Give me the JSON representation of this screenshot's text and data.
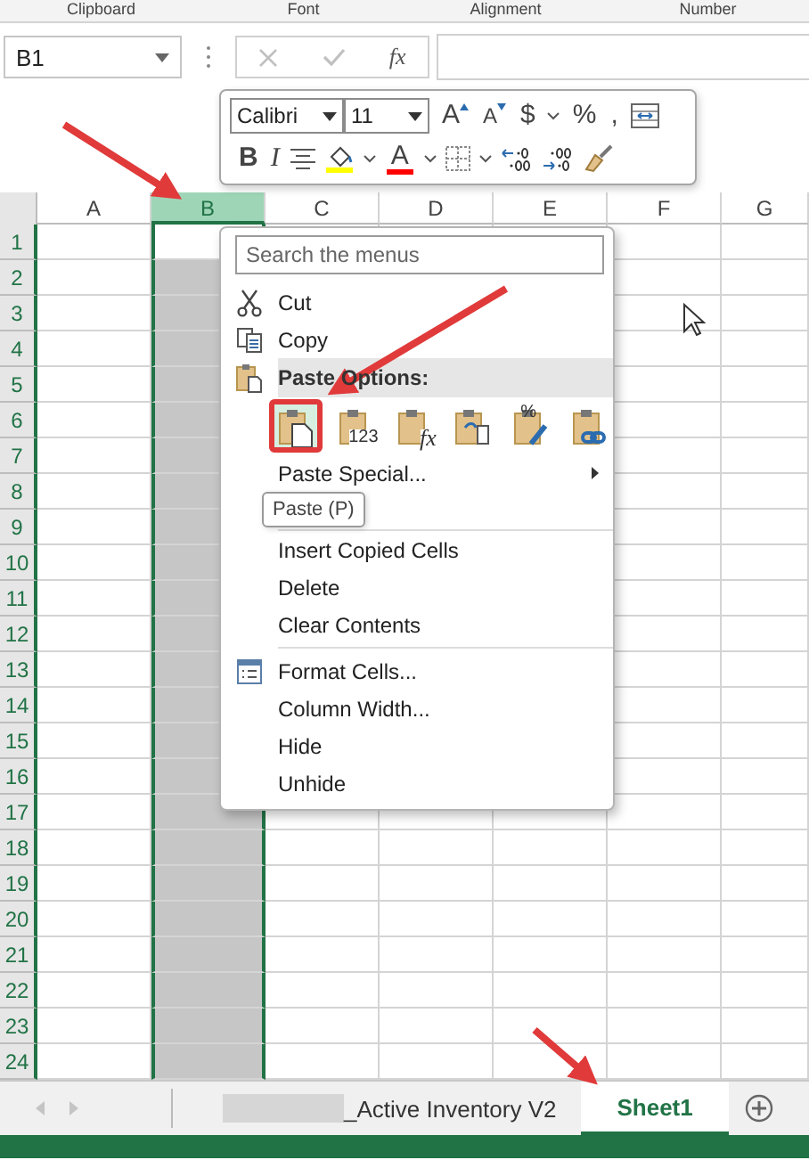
{
  "ribbon_groups": [
    "Clipboard",
    "Font",
    "Alignment",
    "Number"
  ],
  "formula_bar": {
    "name_box": "B1",
    "function_label": "fx"
  },
  "mini_toolbar": {
    "font": "Calibri",
    "size": "11",
    "row1": [
      {
        "kind": "grow",
        "label": "A"
      },
      {
        "kind": "shrink",
        "label": "A"
      },
      {
        "kind": "glyph",
        "label": "$"
      },
      {
        "kind": "caret"
      },
      {
        "kind": "glyph",
        "label": "%"
      },
      {
        "kind": "glyph",
        "label": ","
      },
      {
        "kind": "wrap"
      }
    ],
    "row2": [
      {
        "kind": "bold",
        "label": "B"
      },
      {
        "kind": "italic",
        "label": "I"
      },
      {
        "kind": "align"
      },
      {
        "kind": "fill",
        "color": "#ffff00"
      },
      {
        "kind": "caret"
      },
      {
        "kind": "fontcolor",
        "label": "A",
        "color": "#ff0000"
      },
      {
        "kind": "caret"
      },
      {
        "kind": "borders"
      },
      {
        "kind": "caret"
      },
      {
        "kind": "incdec"
      },
      {
        "kind": "decdec"
      },
      {
        "kind": "painter"
      }
    ]
  },
  "grid": {
    "columns": [
      {
        "label": "A",
        "selected": false
      },
      {
        "label": "B",
        "selected": true
      },
      {
        "label": "C",
        "selected": false
      },
      {
        "label": "D",
        "selected": false
      },
      {
        "label": "E",
        "selected": false
      },
      {
        "label": "F",
        "selected": false
      },
      {
        "label": "G",
        "selected": false
      }
    ],
    "rows": [
      "1",
      "2",
      "3",
      "4",
      "5",
      "6",
      "7",
      "8",
      "9",
      "10",
      "11",
      "12",
      "13",
      "14",
      "15",
      "16",
      "17",
      "18",
      "19",
      "20",
      "21",
      "22",
      "23",
      "24"
    ]
  },
  "context_menu": {
    "search_placeholder": "Search the menus",
    "items": [
      {
        "kind": "cut",
        "label": "Cut"
      },
      {
        "kind": "copy",
        "label": "Copy"
      },
      {
        "kind": "header",
        "label": "Paste Options:"
      },
      {
        "kind": "paste_options",
        "options": [
          {
            "kind": "paste",
            "selected": true
          },
          {
            "kind": "values",
            "label": "123",
            "selected": false
          },
          {
            "kind": "formulas",
            "label": "fx",
            "selected": false
          },
          {
            "kind": "transpose",
            "selected": false
          },
          {
            "kind": "formatting",
            "label": "%",
            "selected": false
          },
          {
            "kind": "link",
            "selected": false
          }
        ]
      },
      {
        "kind": "submenu",
        "label": "Paste Special..."
      },
      {
        "kind": "separator"
      },
      {
        "kind": "item",
        "label": "Insert Copied Cells"
      },
      {
        "kind": "item",
        "label": "Delete"
      },
      {
        "kind": "item",
        "label": "Clear Contents"
      },
      {
        "kind": "separator"
      },
      {
        "kind": "format",
        "label": "Format Cells..."
      },
      {
        "kind": "item",
        "label": "Column Width..."
      },
      {
        "kind": "item",
        "label": "Hide"
      },
      {
        "kind": "item",
        "label": "Unhide"
      }
    ]
  },
  "tooltip": "Paste (P)",
  "sheet_tabs": [
    {
      "label": "_Active Inventory V2",
      "redacted": true,
      "selected": false
    },
    {
      "label": "Sheet1",
      "redacted": false,
      "selected": true
    }
  ]
}
